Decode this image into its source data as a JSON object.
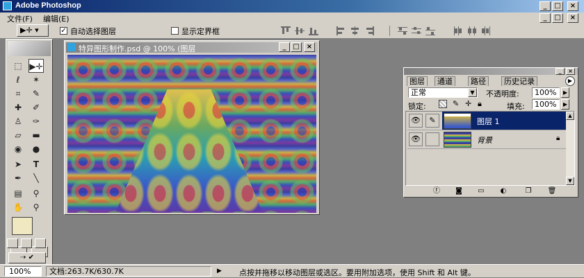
{
  "app": {
    "title": "Adobe Photoshop"
  },
  "menu": {
    "items": [
      "文件(F)",
      "编辑(E)"
    ]
  },
  "options": {
    "auto_select_label": "自动选择图层",
    "auto_select_checked": true,
    "show_bounds_label": "显示定界框",
    "show_bounds_checked": false
  },
  "document": {
    "title": "特异图形制作.psd @ 100% (图层"
  },
  "layers_panel": {
    "tabs": [
      "图层",
      "通道",
      "路径",
      "历史记录"
    ],
    "blend_mode": "正常",
    "opacity_label": "不透明度:",
    "opacity_value": "100%",
    "lock_label": "锁定:",
    "fill_label": "填充:",
    "fill_value": "100%",
    "layers": [
      {
        "name": "图层 1",
        "selected": true
      },
      {
        "name": "背景",
        "selected": false,
        "locked": true
      }
    ]
  },
  "status": {
    "zoom": "100%",
    "doc_size": "文档:263.7K/630.7K",
    "hint": "点按并拖移以移动图层或选区。要用附加选项，使用 Shift 和 Alt 键。"
  },
  "colors": {
    "title_active": "#0a246a",
    "layer_selected": "#0a246a",
    "chrome": "#d4d0c8",
    "workspace": "#808080"
  }
}
